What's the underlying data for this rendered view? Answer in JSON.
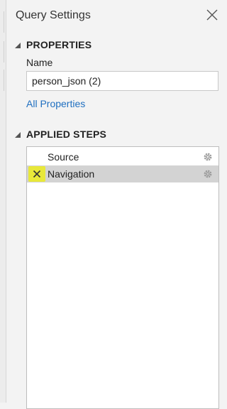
{
  "panel": {
    "title": "Query Settings"
  },
  "properties": {
    "header": "PROPERTIES",
    "name_label": "Name",
    "name_value": "person_json (2)",
    "all_properties_link": "All Properties"
  },
  "applied_steps": {
    "header": "APPLIED STEPS",
    "steps": [
      {
        "label": "Source",
        "selected": false,
        "has_delete_icon": false,
        "icon": "gear-icon"
      },
      {
        "label": "Navigation",
        "selected": true,
        "has_delete_icon": true,
        "icon": "gear-icon"
      }
    ]
  },
  "colors": {
    "link": "#1f6fc0",
    "selected_row": "#d3d3d3",
    "delete_highlight": "#e8e83a"
  }
}
